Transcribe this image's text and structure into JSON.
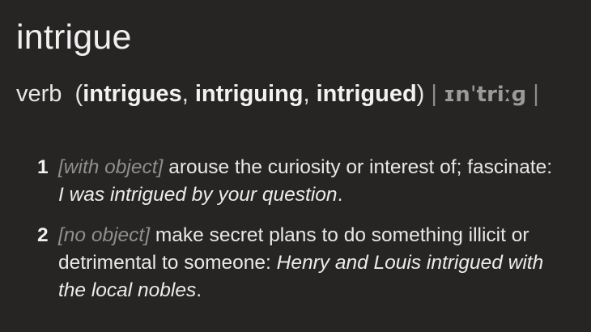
{
  "entry": {
    "headword": "intrigue",
    "part_of_speech": "verb",
    "forms_open": "(",
    "forms": [
      "intrigues",
      "intriguing",
      "intrigued"
    ],
    "forms_close": ")",
    "separator": "|",
    "pronunciation": "ɪnˈtriːɡ",
    "senses": [
      {
        "number": "1",
        "label": "[with object]",
        "definition": "arouse the curiosity or interest of; fascinate:",
        "example": "I was intrigued by your question",
        "end": "."
      },
      {
        "number": "2",
        "label": "[no object]",
        "definition": "make secret plans to do something illicit or detrimental to someone:",
        "example": "Henry and Louis intrigued with the local nobles",
        "end": "."
      }
    ]
  },
  "colors": {
    "background": "#262524",
    "text": "#ececec",
    "muted": "#8f8f8f"
  }
}
